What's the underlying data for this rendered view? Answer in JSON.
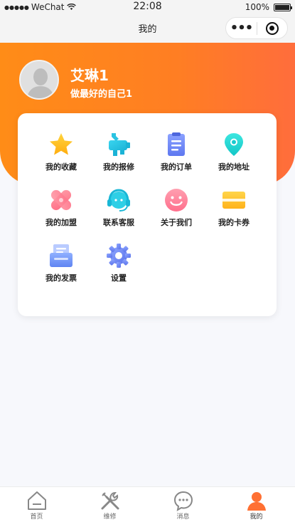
{
  "status_bar": {
    "carrier": "WeChat",
    "time": "22:08",
    "battery": "100%"
  },
  "nav": {
    "title": "我的"
  },
  "profile": {
    "name": "艾琳1",
    "motto": "做最好的自己1"
  },
  "menu": [
    {
      "label": "我的收藏",
      "icon": "star-icon"
    },
    {
      "label": "我的报修",
      "icon": "repair-icon"
    },
    {
      "label": "我的订单",
      "icon": "order-clipboard-icon"
    },
    {
      "label": "我的地址",
      "icon": "location-pin-icon"
    },
    {
      "label": "我的加盟",
      "icon": "join-icon"
    },
    {
      "label": "联系客服",
      "icon": "headset-icon"
    },
    {
      "label": "关于我们",
      "icon": "smiley-icon"
    },
    {
      "label": "我的卡券",
      "icon": "card-coupon-icon"
    },
    {
      "label": "我的发票",
      "icon": "invoice-icon"
    },
    {
      "label": "设置",
      "icon": "gear-icon"
    }
  ],
  "tabbar": [
    {
      "label": "首页",
      "icon": "home-icon"
    },
    {
      "label": "维修",
      "icon": "tools-icon"
    },
    {
      "label": "消息",
      "icon": "message-icon"
    },
    {
      "label": "我的",
      "icon": "user-icon"
    }
  ],
  "colors": {
    "accent": "#ff7e23",
    "hero_start": "#ff8c17",
    "hero_end": "#ff6d3c"
  }
}
